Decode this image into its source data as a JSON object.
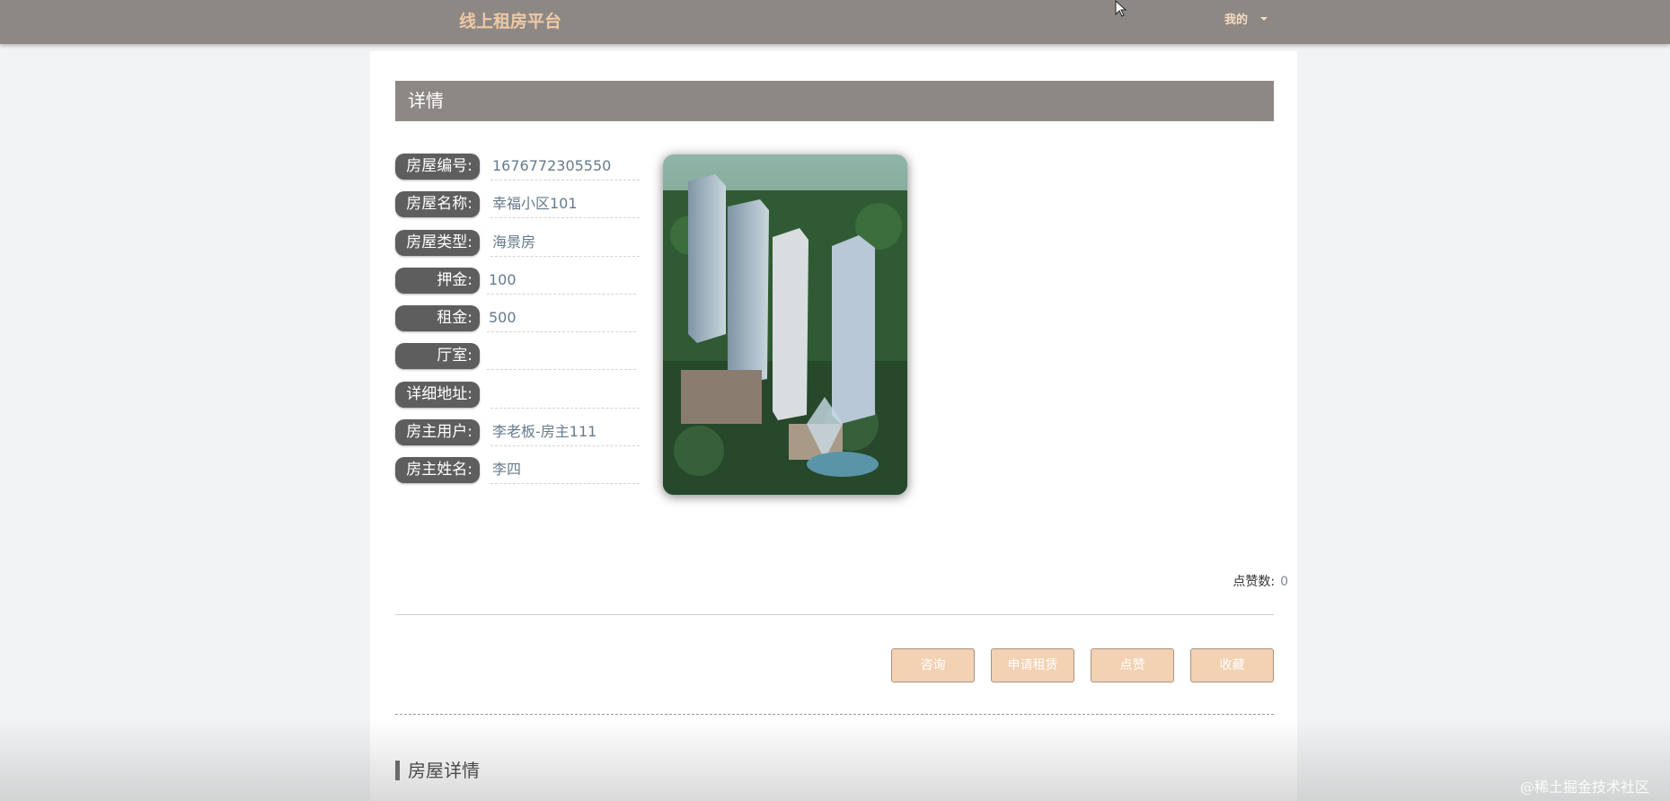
{
  "header": {
    "brand": "线上租房平台",
    "mine_label": "我的"
  },
  "detail": {
    "section_title": "详情",
    "fields": [
      {
        "label": "房屋编号:",
        "value": "1676772305550"
      },
      {
        "label": "房屋名称:",
        "value": "幸福小区101"
      },
      {
        "label": "房屋类型:",
        "value": "海景房"
      },
      {
        "label": "押金:",
        "value": "100"
      },
      {
        "label": "租金:",
        "value": "500"
      },
      {
        "label": "厅室:",
        "value": ""
      },
      {
        "label": "详细地址:",
        "value": ""
      },
      {
        "label": "房主用户:",
        "value": "李老板-房主111"
      },
      {
        "label": "房主姓名:",
        "value": "李四"
      }
    ],
    "likes_label": "点赞数:",
    "likes_value": "0",
    "buttons": {
      "consult": "咨询",
      "apply": "申请租赁",
      "like": "点赞",
      "favorite": "收藏"
    },
    "subsection_title": "房屋详情"
  },
  "watermark": "@稀土掘金技术社区",
  "colors": {
    "topbar": "#8e8884",
    "brand": "#eec9a5",
    "label_bg": "#5e5e5e",
    "button_bg": "#f3d1b3"
  }
}
